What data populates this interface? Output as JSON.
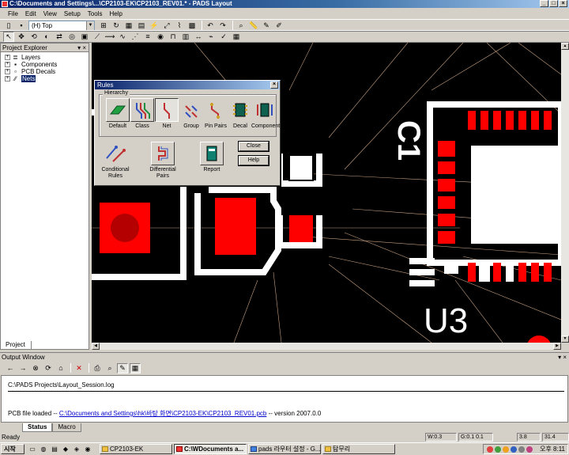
{
  "window": {
    "title": "C:\\Documents and Settings\\...\\CP2103-EK\\CP2103_REV01.* - PADS Layout"
  },
  "menu": [
    "File",
    "Edit",
    "View",
    "Setup",
    "Tools",
    "Help"
  ],
  "toolbar": {
    "layer_value": "(H) Top"
  },
  "explorer": {
    "title": "Project Explorer",
    "items": [
      {
        "label": "Layers",
        "icon": "layers-icon"
      },
      {
        "label": "Components",
        "icon": "components-icon"
      },
      {
        "label": "PCB Decals",
        "icon": "pcb-decals-icon"
      },
      {
        "label": "Nets",
        "icon": "nets-icon"
      }
    ],
    "tab": "Project"
  },
  "pcb": {
    "labels": [
      "C1",
      "U3"
    ],
    "colors": {
      "background": "#000000",
      "pad": "#ff0000",
      "silkscreen": "#ffffff",
      "ratsnest": "#c8a080"
    }
  },
  "rules_dialog": {
    "title": "Rules",
    "group_label": "Hierarchy",
    "hierarchy_items": [
      "Default",
      "Class",
      "Net",
      "Group",
      "Pin Pairs",
      "Decal",
      "Component"
    ],
    "pressed_item": "Net",
    "other_items": [
      "Conditional Rules",
      "Differential Pairs",
      "Report"
    ],
    "close_label": "Close",
    "help_label": "Help"
  },
  "output": {
    "title": "Output Window",
    "line1": "C:\\PADS Projects\\Layout_Session.log",
    "line2_prefix": "PCB file loaded -- ",
    "line2_link": "C:\\Documents and Settings\\hk\\바탕 화면\\CP2103-EK\\CP2103_REV01.pcb",
    "line2_suffix": " -- version 2007.0.0",
    "tabs": [
      "Status",
      "Macro"
    ]
  },
  "status": {
    "left": "Ready",
    "w": "W:0.3",
    "g": "G:0.1 0.1",
    "x": "3.8",
    "y": "31.4"
  },
  "taskbar": {
    "start": "시작",
    "tasks": [
      "CP2103-EK",
      "C:\\WDocuments a...",
      "pads 라우터 설정 - G...",
      "탐무리"
    ],
    "active_task": 1,
    "clock": "오후 8:11"
  }
}
